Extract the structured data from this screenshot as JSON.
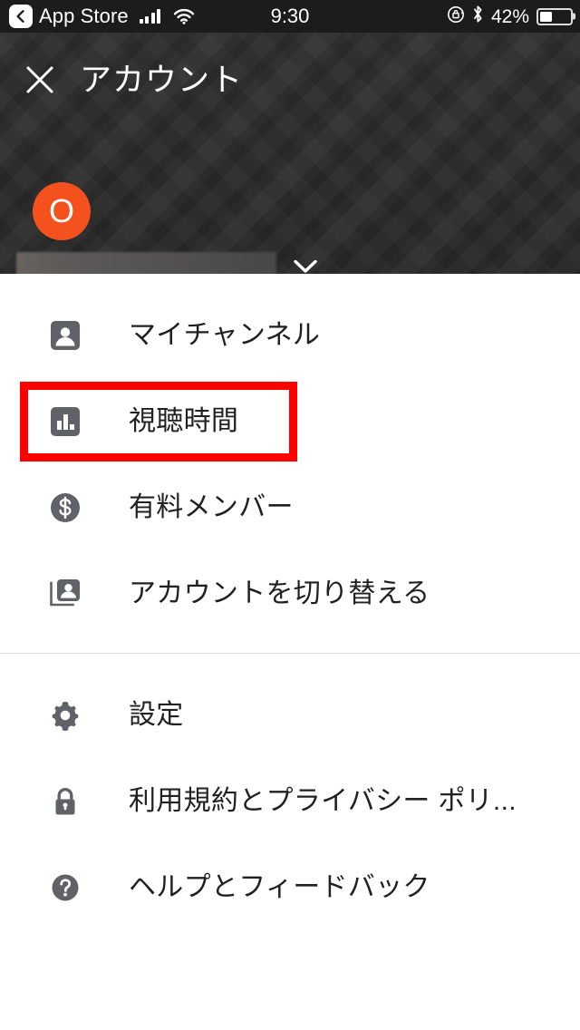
{
  "status_bar": {
    "back_icon": "back-chevron-icon",
    "carrier_label": "App Store",
    "signal_icon": "cellular-signal-icon",
    "wifi_icon": "wifi-icon",
    "time": "9:30",
    "rotation_lock_icon": "rotation-lock-icon",
    "bluetooth_icon": "bluetooth-icon",
    "battery_percent": "42%",
    "battery_level": 42,
    "battery_icon": "battery-icon"
  },
  "header": {
    "close_icon": "close-x-icon",
    "title": "アカウント",
    "avatar": {
      "initial": "O",
      "color": "#F4511E"
    },
    "account_name": "",
    "account_name_redacted": true,
    "chevron_icon": "chevron-down-icon"
  },
  "menu": {
    "group_primary": [
      {
        "icon": "person-card-icon",
        "label": "マイチャンネル"
      },
      {
        "icon": "bar-chart-icon",
        "label": "視聴時間"
      },
      {
        "icon": "dollar-circle-icon",
        "label": "有料メンバー"
      },
      {
        "icon": "switch-account-icon",
        "label": "アカウントを切り替える"
      }
    ],
    "group_secondary": [
      {
        "icon": "gear-icon",
        "label": "設定"
      },
      {
        "icon": "lock-icon",
        "label": "利用規約とプライバシー ポリ..."
      },
      {
        "icon": "help-circle-icon",
        "label": "ヘルプとフィードバック"
      }
    ]
  },
  "annotation": {
    "highlight_target": "視聴時間",
    "highlight_color": "#FF0000"
  }
}
